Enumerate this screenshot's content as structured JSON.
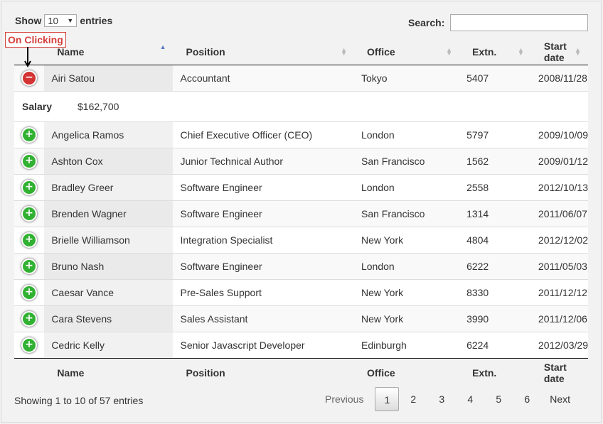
{
  "length": {
    "show": "Show",
    "value": "10",
    "entries": "entries"
  },
  "search": {
    "label": "Search:",
    "value": ""
  },
  "annotation": {
    "text": "On Clicking"
  },
  "columns": [
    "Name",
    "Position",
    "Office",
    "Extn.",
    "Start date"
  ],
  "rows": [
    {
      "name": "Airi Satou",
      "position": "Accountant",
      "office": "Tokyo",
      "extn": "5407",
      "start": "2008/11/28",
      "expanded": true
    },
    {
      "name": "Angelica Ramos",
      "position": "Chief Executive Officer (CEO)",
      "office": "London",
      "extn": "5797",
      "start": "2009/10/09"
    },
    {
      "name": "Ashton Cox",
      "position": "Junior Technical Author",
      "office": "San Francisco",
      "extn": "1562",
      "start": "2009/01/12"
    },
    {
      "name": "Bradley Greer",
      "position": "Software Engineer",
      "office": "London",
      "extn": "2558",
      "start": "2012/10/13"
    },
    {
      "name": "Brenden Wagner",
      "position": "Software Engineer",
      "office": "San Francisco",
      "extn": "1314",
      "start": "2011/06/07"
    },
    {
      "name": "Brielle Williamson",
      "position": "Integration Specialist",
      "office": "New York",
      "extn": "4804",
      "start": "2012/12/02"
    },
    {
      "name": "Bruno Nash",
      "position": "Software Engineer",
      "office": "London",
      "extn": "6222",
      "start": "2011/05/03"
    },
    {
      "name": "Caesar Vance",
      "position": "Pre-Sales Support",
      "office": "New York",
      "extn": "8330",
      "start": "2011/12/12"
    },
    {
      "name": "Cara Stevens",
      "position": "Sales Assistant",
      "office": "New York",
      "extn": "3990",
      "start": "2011/12/06"
    },
    {
      "name": "Cedric Kelly",
      "position": "Senior Javascript Developer",
      "office": "Edinburgh",
      "extn": "6224",
      "start": "2012/03/29"
    }
  ],
  "child": {
    "label": "Salary",
    "value": "$162,700"
  },
  "info": "Showing 1 to 10 of 57 entries",
  "pagination": {
    "previous": "Previous",
    "pages": [
      "1",
      "2",
      "3",
      "4",
      "5",
      "6"
    ],
    "current": "1",
    "next": "Next"
  },
  "icons": {
    "expand": "plus-circle-icon",
    "collapse": "minus-circle-icon",
    "sort": "sort-arrows-icon"
  },
  "colors": {
    "expand": "#31b131",
    "collapse": "#d33333",
    "annotation": "#d43f3a",
    "sort_active": "#5a7dc7"
  }
}
